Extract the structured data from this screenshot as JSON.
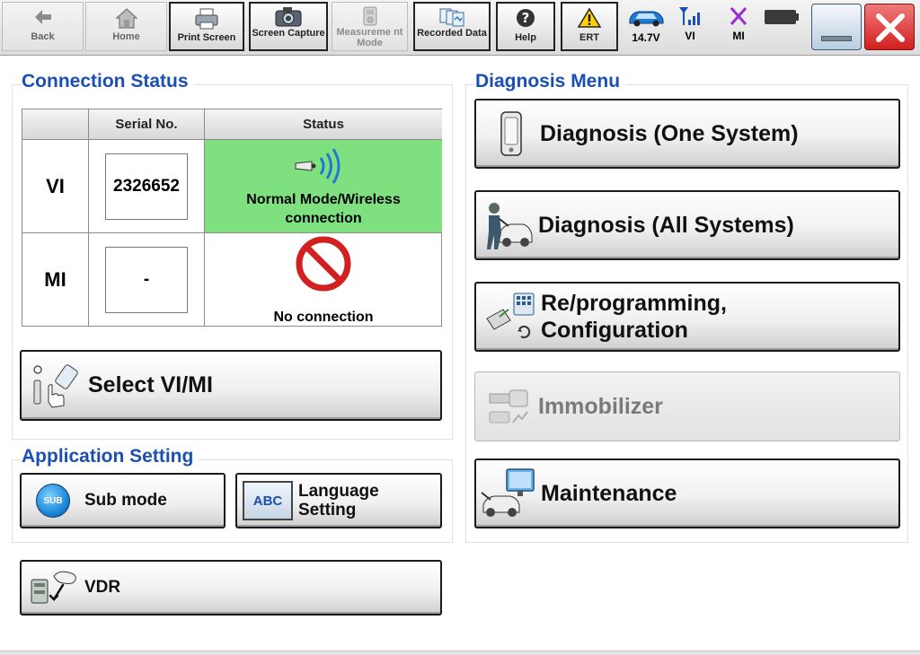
{
  "toolbar": {
    "back": "Back",
    "home": "Home",
    "print_screen": "Print Screen",
    "screen_capture": "Screen Capture",
    "measurement_mode": "Measureme nt Mode",
    "recorded_data": "Recorded Data",
    "help": "Help",
    "ert": "ERT",
    "battery_voltage": "14.7V",
    "vi": "VI",
    "mi": "MI"
  },
  "connection_status": {
    "title": "Connection Status",
    "col_serial": "Serial No.",
    "col_status": "Status",
    "rows": [
      {
        "label": "VI",
        "serial": "2326652",
        "status": "Normal Mode/Wireless connection"
      },
      {
        "label": "MI",
        "serial": "-",
        "status": "No connection"
      }
    ],
    "select_button": "Select VI/MI"
  },
  "application_setting": {
    "title": "Application Setting",
    "sub_mode": "Sub mode",
    "sub_badge": "SUB",
    "language": "Language Setting",
    "abc_badge": "ABC"
  },
  "vdr_button": "VDR",
  "diagnosis_menu": {
    "title": "Diagnosis Menu",
    "items": [
      {
        "label": "Diagnosis (One System)",
        "enabled": true
      },
      {
        "label": "Diagnosis (All Systems)",
        "enabled": true
      },
      {
        "label": "Re/programming, Configuration",
        "enabled": true
      },
      {
        "label": "Immobilizer",
        "enabled": false
      },
      {
        "label": "Maintenance",
        "enabled": true
      }
    ]
  },
  "colors": {
    "title_blue": "#1a4fb4",
    "status_green": "#7ee07e",
    "no_connection_red": "#d21f1f",
    "close_red": "#e23b3b"
  }
}
